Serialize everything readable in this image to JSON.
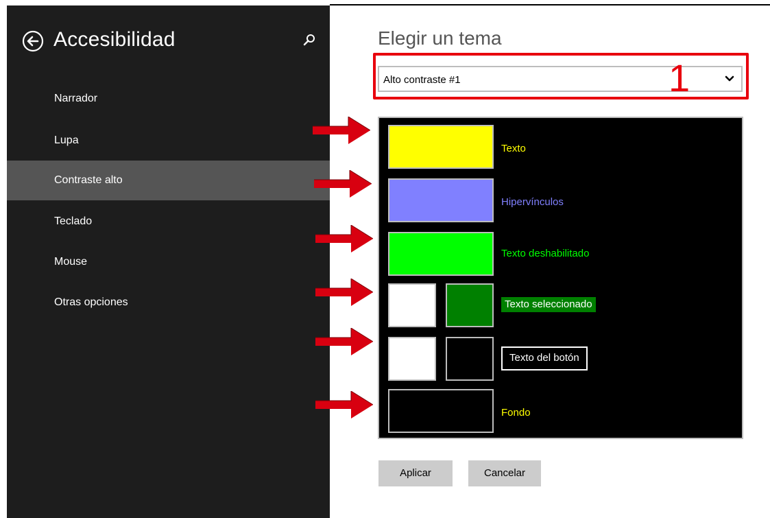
{
  "sidebar": {
    "title": "Accesibilidad",
    "items": [
      {
        "label": "Narrador"
      },
      {
        "label": "Lupa"
      },
      {
        "label": "Contraste alto"
      },
      {
        "label": "Teclado"
      },
      {
        "label": "Mouse"
      },
      {
        "label": "Otras opciones"
      }
    ],
    "selected": "Contraste alto"
  },
  "main": {
    "title": "Elegir un tema",
    "theme_select": {
      "value": "Alto contraste #1"
    },
    "annotation_number": "1",
    "preview": {
      "text_label": "Texto",
      "hyperlinks_label": "Hipervínculos",
      "disabled_text_label": "Texto deshabilitado",
      "selected_text_label": "Texto seleccionado",
      "button_text_label": "Texto del botón",
      "background_label": "Fondo"
    },
    "apply_label": "Aplicar",
    "cancel_label": "Cancelar"
  },
  "colors": {
    "text": "#ffff00",
    "hyperlinks": "#8080ff",
    "disabled_text": "#00ff00",
    "selected_text_fg": "#ffffff",
    "selected_text_bg": "#008000",
    "button_text_fg": "#ffffff",
    "button_text_bg": "#000000",
    "background": "#000000",
    "annotation": "#e8000d"
  }
}
